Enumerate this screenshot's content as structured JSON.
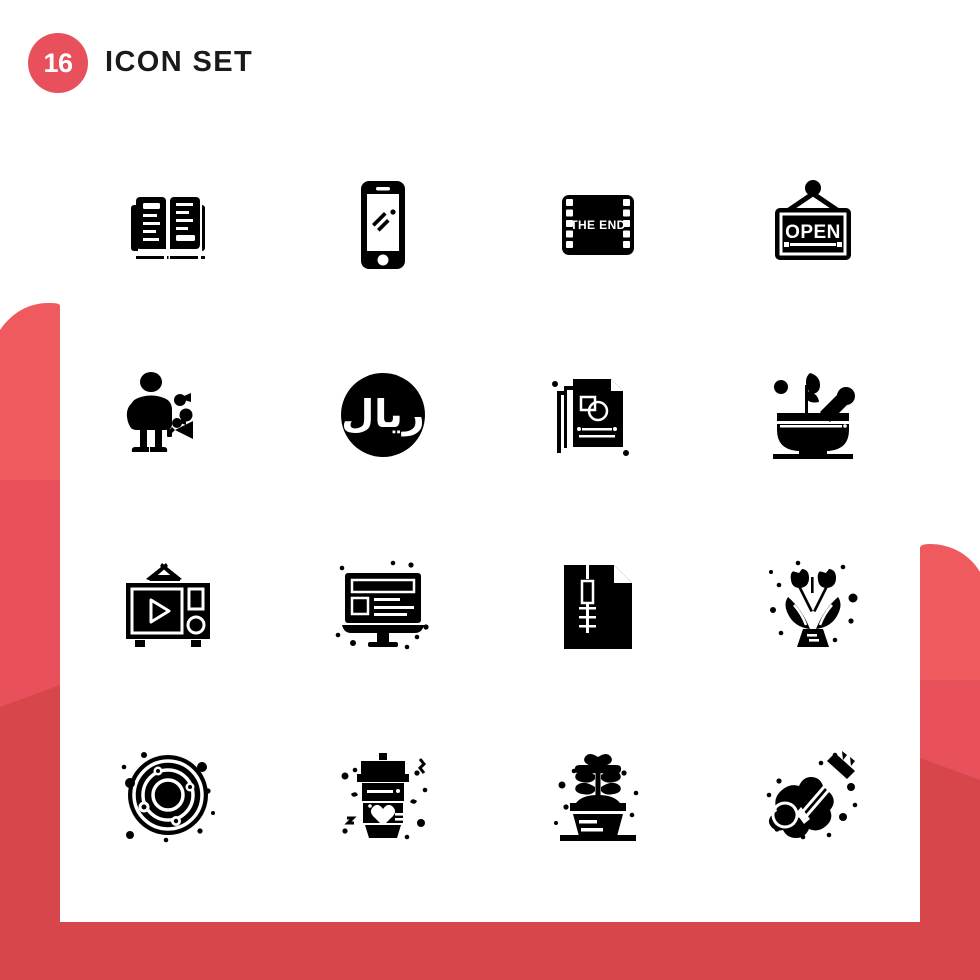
{
  "header": {
    "count": "16",
    "title": "Icon Set",
    "badge_color": "#e8505b",
    "title_color": "#1a1a1a"
  },
  "theme": {
    "background": "#ffffff",
    "panel": "#ffffff",
    "accent_light": "#ef5a5f",
    "accent": "#e8505b",
    "accent_dark": "#d6464b",
    "icon_color": "#000000"
  },
  "grid": {
    "columns": 4,
    "rows": 4,
    "icons": [
      {
        "name": "open-book-icon",
        "label": "Open book"
      },
      {
        "name": "smartphone-icon",
        "label": "Smartphone"
      },
      {
        "name": "film-the-end-icon",
        "label": "Film strip",
        "text": "THE END"
      },
      {
        "name": "open-sign-icon",
        "label": "Hanging sign",
        "text": "OPEN"
      },
      {
        "name": "bubble-blower-icon",
        "label": "Person blowing bubbles"
      },
      {
        "name": "saudi-riyal-icon",
        "label": "Saudi riyal",
        "text": "ريال"
      },
      {
        "name": "documents-stack-icon",
        "label": "Document files"
      },
      {
        "name": "mortar-pestle-icon",
        "label": "Mortar and pestle"
      },
      {
        "name": "retro-tv-icon",
        "label": "Retro television"
      },
      {
        "name": "desktop-monitor-icon",
        "label": "Desktop monitor"
      },
      {
        "name": "zip-file-icon",
        "label": "Zip archive file"
      },
      {
        "name": "flower-bouquet-icon",
        "label": "Flower bouquet"
      },
      {
        "name": "solar-system-icon",
        "label": "Solar system"
      },
      {
        "name": "coffee-cup-heart-icon",
        "label": "Coffee cup with heart"
      },
      {
        "name": "potted-plant-icon",
        "label": "Potted plant"
      },
      {
        "name": "guitar-icon",
        "label": "Guitar"
      }
    ]
  }
}
